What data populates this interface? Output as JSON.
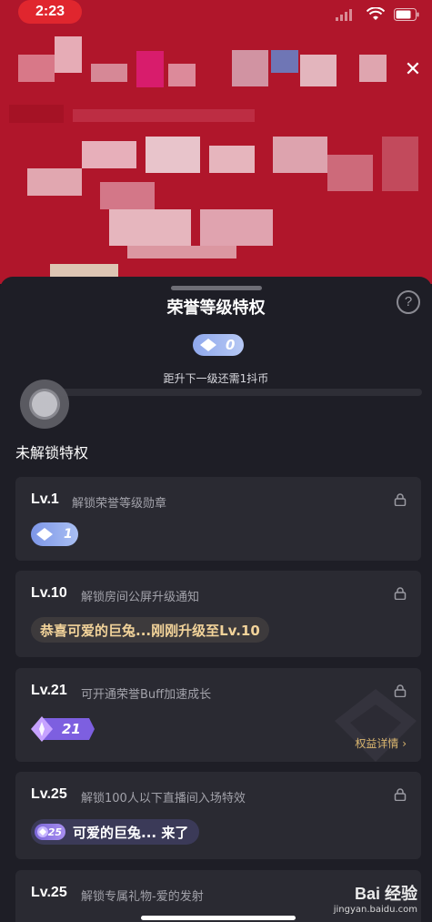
{
  "status": {
    "time": "2:23"
  },
  "sheet": {
    "title": "荣誉等级特权",
    "help_label": "?",
    "current_level": "0",
    "next_level_text": "距升下一级还需1抖币",
    "progress": 0.0,
    "section_title": "未解锁特权"
  },
  "cards": [
    {
      "level": "Lv.1",
      "description": "解锁荣誉等级勋章",
      "badge_value": "1"
    },
    {
      "level": "Lv.10",
      "description": "解锁房间公屏升级通知",
      "notice_text": "恭喜可爱的巨兔...刚刚升级至Lv.10"
    },
    {
      "level": "Lv.21",
      "description": "可开通荣誉Buff加速成长",
      "badge_value": "21",
      "detail_link": "权益详情 ›"
    },
    {
      "level": "Lv.25",
      "description": "解锁100人以下直播间入场特效",
      "badge_value": "25",
      "enter_text": "可爱的巨兔... 来了"
    },
    {
      "level": "Lv.25",
      "description": "解锁专属礼物-爱的发射"
    }
  ],
  "watermark": {
    "brand": "Bai 经验",
    "url": "jingyan.baidu.com"
  },
  "icons": {
    "close": "close-icon",
    "lock": "lock-icon",
    "diamond": "diamond-icon",
    "wifi": "wifi-icon",
    "battery": "battery-icon",
    "signal": "signal-icon"
  }
}
